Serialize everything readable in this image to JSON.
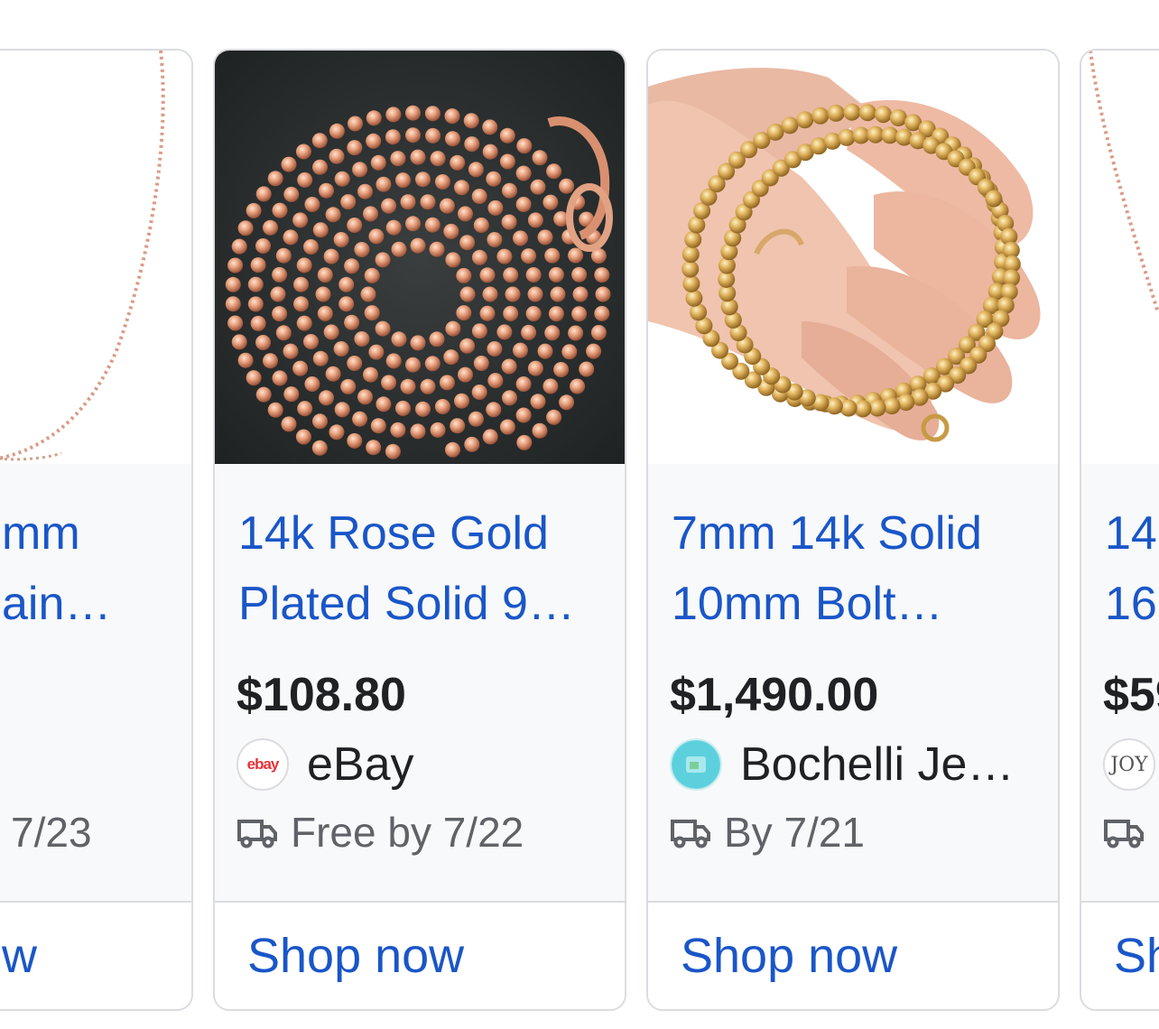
{
  "cards": [
    {
      "title_line1": "mm",
      "title_line2": "ain…",
      "price": "",
      "seller_name": "",
      "seller_logo": "",
      "delivery": "7/23",
      "action_label": "w",
      "image_icon": "rose-gold-chain-image"
    },
    {
      "title_line1": "14k Rose Gold",
      "title_line2": "Plated Solid 9…",
      "price": "$108.80",
      "seller_name": "eBay",
      "seller_logo": "ebay",
      "delivery": "Free by 7/22",
      "action_label": "Shop now",
      "image_icon": "rose-gold-bead-chain-image"
    },
    {
      "title_line1": "7mm 14k Solid",
      "title_line2": "10mm Bolt…",
      "price": "$1,490.00",
      "seller_name": "Bochelli Je…",
      "seller_logo": "",
      "delivery": "By 7/21",
      "action_label": "Shop now",
      "image_icon": "gold-bead-necklace-in-hand-image"
    },
    {
      "title_line1": "14",
      "title_line2": "16",
      "price": "$59",
      "seller_name": "",
      "seller_logo": "JOY",
      "delivery": "",
      "action_label": "Sh",
      "image_icon": "rose-gold-chain-image"
    }
  ],
  "colors": {
    "link": "#1a56c8",
    "price": "#202124",
    "muted": "#5f6368",
    "card_bg": "#f8f9fa",
    "border": "#dadce0"
  }
}
